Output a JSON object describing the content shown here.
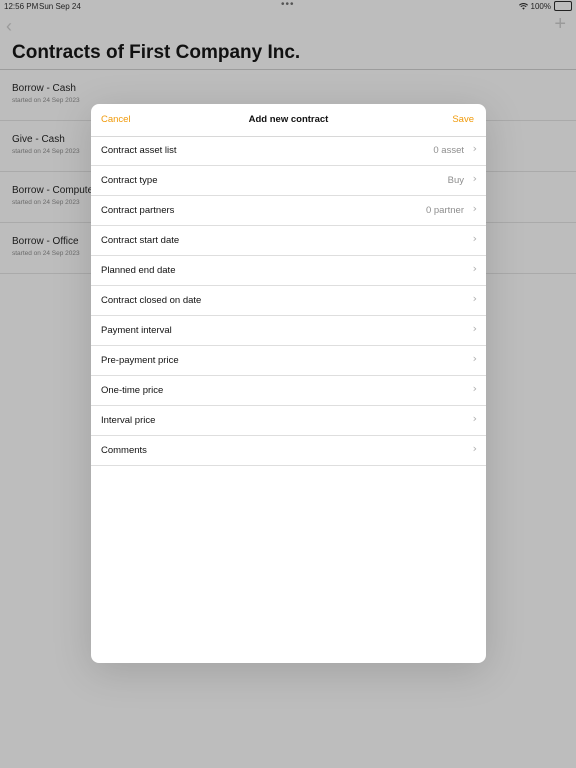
{
  "status_bar": {
    "time": "12:56 PM",
    "date": "Sun Sep 24",
    "battery_pct": "100%",
    "battery_icon": "battery-full-icon",
    "wifi_icon": "wifi-icon"
  },
  "nav": {
    "back_icon": "chevron-left-icon",
    "back_glyph": "‹",
    "add_icon": "plus-icon",
    "add_glyph": "+"
  },
  "page": {
    "title": "Contracts of First Company Inc."
  },
  "contracts": [
    {
      "title": "Borrow - Cash",
      "subtitle": "started on 24 Sep 2023"
    },
    {
      "title": "Give - Cash",
      "subtitle": "started on 24 Sep 2023"
    },
    {
      "title": "Borrow - Computer",
      "subtitle": "started on 24 Sep 2023"
    },
    {
      "title": "Borrow - Office",
      "subtitle": "started on 24 Sep 2023"
    }
  ],
  "modal": {
    "title": "Add new contract",
    "cancel_label": "Cancel",
    "save_label": "Save",
    "accent_color": "#f09a0a",
    "rows": [
      {
        "label": "Contract asset list",
        "value": "0 asset"
      },
      {
        "label": "Contract type",
        "value": "Buy"
      },
      {
        "label": "Contract partners",
        "value": "0 partner"
      },
      {
        "label": "Contract start date",
        "value": ""
      },
      {
        "label": "Planned end date",
        "value": ""
      },
      {
        "label": "Contract closed on date",
        "value": ""
      },
      {
        "label": "Payment interval",
        "value": ""
      },
      {
        "label": "Pre-payment price",
        "value": ""
      },
      {
        "label": "One-time price",
        "value": ""
      },
      {
        "label": "Interval price",
        "value": ""
      },
      {
        "label": "Comments",
        "value": ""
      }
    ],
    "chevron_icon": "chevron-right-icon"
  }
}
